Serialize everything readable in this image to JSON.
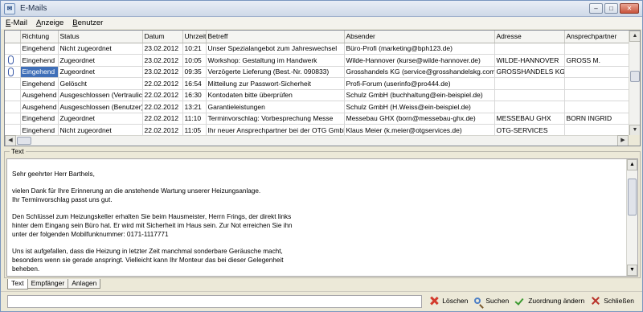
{
  "window": {
    "title": "E-Mails",
    "buttons": {
      "minimize": "–",
      "maximize": "□",
      "close": "✕"
    }
  },
  "menu": [
    {
      "label": "E-Mail",
      "underline": "E"
    },
    {
      "label": "Anzeige",
      "underline": "A"
    },
    {
      "label": "Benutzer",
      "underline": "B"
    }
  ],
  "grid": {
    "columns": [
      "",
      "Richtung",
      "Status",
      "Datum",
      "Uhrzeit",
      "Betreff",
      "Absender",
      "Adresse",
      "Ansprechpartner"
    ],
    "rows": [
      {
        "attachment": false,
        "selected": false,
        "richtung": "Eingehend",
        "status": "Nicht zugeordnet",
        "datum": "23.02.2012",
        "uhrzeit": "10:21",
        "betreff": "Unser Spezialangebot zum Jahreswechsel",
        "absender": "Büro-Profi (marketing@bph123.de)",
        "adresse": "",
        "ansprechpartner": ""
      },
      {
        "attachment": true,
        "selected": false,
        "richtung": "Eingehend",
        "status": "Zugeordnet",
        "datum": "23.02.2012",
        "uhrzeit": "10:05",
        "betreff": "Workshop: Gestaltung im Handwerk",
        "absender": "Wilde-Hannover (kurse@wilde-hannover.de)",
        "adresse": "WILDE-HANNOVER",
        "ansprechpartner": "GROSS M."
      },
      {
        "attachment": true,
        "selected": true,
        "richtung": "Eingehend",
        "status": "Zugeordnet",
        "datum": "23.02.2012",
        "uhrzeit": "09:35",
        "betreff": "Verzögerte Lieferung (Best.-Nr. 090833)",
        "absender": "Grosshandels KG (service@grosshandelskg.com)",
        "adresse": "GROSSHANDELS KG",
        "ansprechpartner": ""
      },
      {
        "attachment": false,
        "selected": false,
        "richtung": "Eingehend",
        "status": "Gelöscht",
        "datum": "22.02.2012",
        "uhrzeit": "16:54",
        "betreff": "Mitteilung zur Passwort-Sicherheit",
        "absender": "Profi-Forum (userinfo@pro444.de)",
        "adresse": "",
        "ansprechpartner": ""
      },
      {
        "attachment": false,
        "selected": false,
        "richtung": "Ausgehend",
        "status": "Ausgeschlossen (Vertraulich)",
        "datum": "22.02.2012",
        "uhrzeit": "16:30",
        "betreff": "Kontodaten bitte überprüfen",
        "absender": "Schulz GmbH (buchhaltung@ein-beispiel.de)",
        "adresse": "",
        "ansprechpartner": ""
      },
      {
        "attachment": false,
        "selected": false,
        "richtung": "Ausgehend",
        "status": "Ausgeschlossen (Benutzer)",
        "datum": "22.02.2012",
        "uhrzeit": "13:21",
        "betreff": "Garantieleistungen",
        "absender": "Schulz GmbH (H.Weiss@ein-beispiel.de)",
        "adresse": "",
        "ansprechpartner": ""
      },
      {
        "attachment": false,
        "selected": false,
        "richtung": "Eingehend",
        "status": "Zugeordnet",
        "datum": "22.02.2012",
        "uhrzeit": "11:10",
        "betreff": "Terminvorschlag: Vorbesprechung Messe",
        "absender": "Messebau GHX (born@messebau-ghx.de)",
        "adresse": "MESSEBAU GHX",
        "ansprechpartner": "BORN INGRID"
      },
      {
        "attachment": false,
        "selected": false,
        "richtung": "Eingehend",
        "status": "Nicht zugeordnet",
        "datum": "22.02.2012",
        "uhrzeit": "11:05",
        "betreff": "Ihr neuer Ansprechpartner bei der OTG GmbH",
        "absender": "Klaus Meier (k.meier@otgservices.de)",
        "adresse": "OTG-SERVICES",
        "ansprechpartner": ""
      }
    ]
  },
  "text_section": {
    "legend": "Text",
    "lines": [
      "Sehr geehrter Herr Barthels,",
      "",
      "vielen Dank für Ihre Erinnerung an die anstehende Wartung unserer Heizungsanlage.",
      "Ihr Terminvorschlag passt uns gut.",
      "",
      "Den Schlüssel zum Heizungskeller erhalten Sie beim Hausmeister, Herrn Frings, der direkt links",
      "hinter dem Eingang sein Büro hat. Er wird mit Sicherheit im Haus sein. Zur Not erreichen Sie ihn",
      "unter der folgenden Mobilfunknummer: 0171-1117771",
      "",
      "Uns ist aufgefallen, dass die Heizung in letzter Zeit manchmal sonderbare Geräusche macht,",
      "besonders wenn sie gerade anspringt. Vielleicht kann Ihr Monteur das bei dieser Gelegenheit",
      "beheben."
    ]
  },
  "tabs": [
    "Text",
    "Empfänger",
    "Anlagen"
  ],
  "actions": {
    "delete": "Löschen",
    "search": "Suchen",
    "change_assignment": "Zuordnung ändern",
    "close": "Schließen"
  }
}
